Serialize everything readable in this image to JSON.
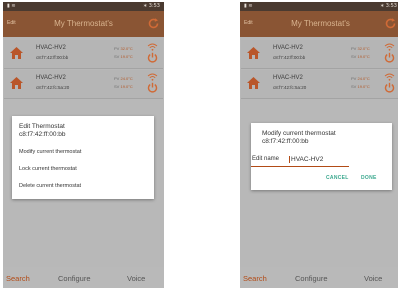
{
  "colors": {
    "accent": "#b24b16",
    "titlebar": "#8a5534",
    "dialog_button": "#3aa88e"
  },
  "left_phone": {
    "status": {
      "left": "▮ ≋",
      "right": "∗ 3:53"
    },
    "title": "My Thermostat's",
    "edit": "Edit",
    "devices": [
      {
        "name": "HVAC-HV2",
        "mac": "c8:f7:42:ff:00:bb",
        "pv_label": "PV",
        "pv": "32.0°C",
        "sv_label": "SV",
        "sv": "19.0°C"
      },
      {
        "name": "HVAC-HV2",
        "mac": "c8:f7:42:fc:5a:20",
        "pv_label": "PV",
        "pv": "24.0°C",
        "sv_label": "SV",
        "sv": "19.0°C"
      }
    ],
    "dialog": {
      "title": "Edit Thermostat",
      "subtitle": "c8:f7:42:ff:00:bb",
      "items": [
        "Modify current thermostat",
        "Lock current thermostat",
        "Delete current thermostat"
      ]
    },
    "tabs": [
      "Search",
      "Configure",
      "Voice"
    ]
  },
  "right_phone": {
    "status": {
      "left": "▮ ≋",
      "right": "∗ 3:53"
    },
    "title": "My Thermostat's",
    "edit": "Edit",
    "devices": [
      {
        "name": "HVAC-HV2",
        "mac": "c8:f7:42:ff:00:bb",
        "pv_label": "PV",
        "pv": "32.0°C",
        "sv_label": "SV",
        "sv": "19.0°C"
      },
      {
        "name": "HVAC-HV2",
        "mac": "c8:f7:42:fc:5a:20",
        "pv_label": "PV",
        "pv": "24.0°C",
        "sv_label": "SV",
        "sv": "19.0°C"
      }
    ],
    "dialog": {
      "title": "Modify current thermostat",
      "subtitle": "c8:f7:42:ff:00:bb",
      "field_label": "Edit name",
      "field_value": "HVAC-HV2",
      "cancel": "CANCEL",
      "done": "DONE"
    },
    "tabs": [
      "Search",
      "Configure",
      "Voice"
    ]
  }
}
